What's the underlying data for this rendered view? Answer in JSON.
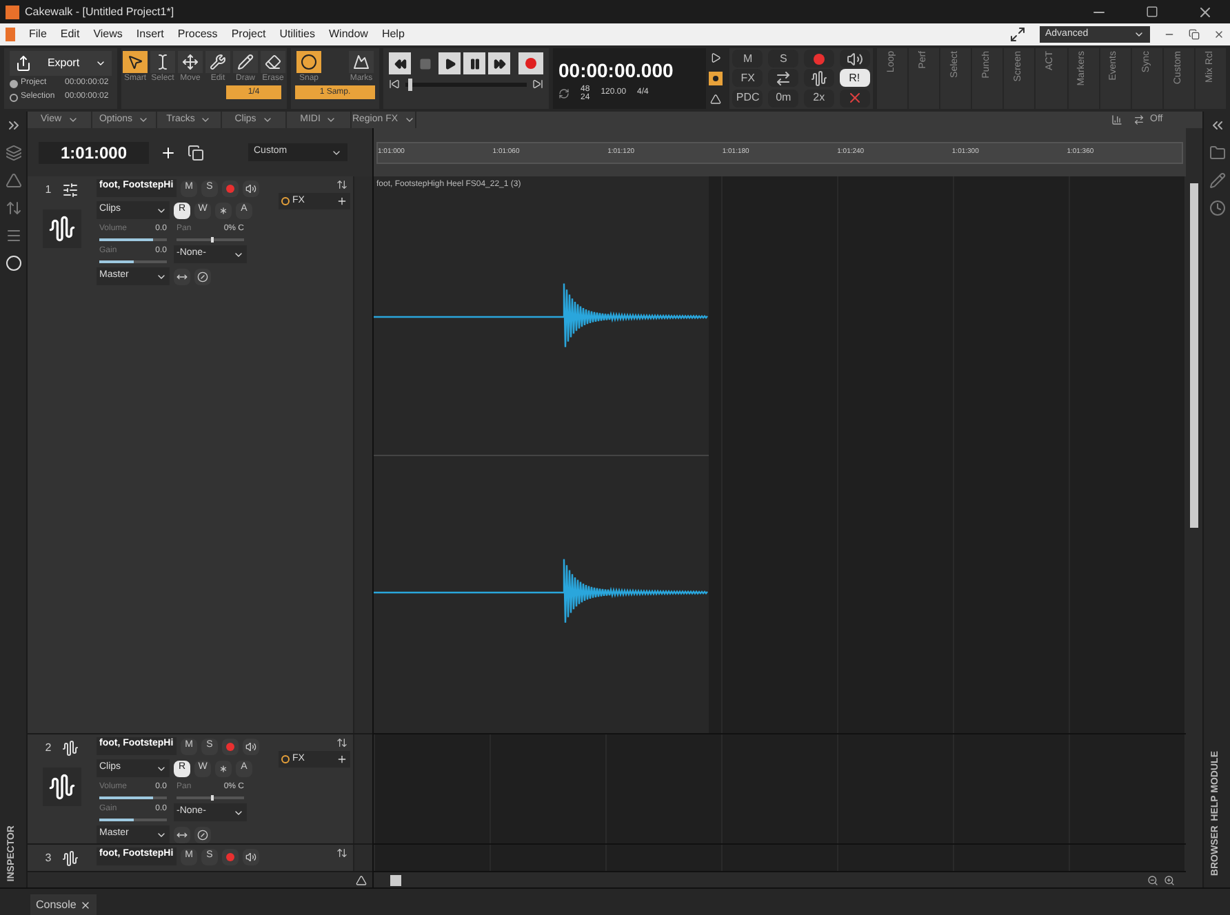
{
  "window": {
    "title": "Cakewalk - [Untitled Project1*]"
  },
  "menu": [
    "File",
    "Edit",
    "Views",
    "Insert",
    "Process",
    "Project",
    "Utilities",
    "Window",
    "Help"
  ],
  "workspace": {
    "value": "Advanced"
  },
  "export": {
    "label": "Export",
    "options": [
      {
        "label": "Project",
        "time": "00:00:00:02",
        "selected": true
      },
      {
        "label": "Selection",
        "time": "00:00:00:02",
        "selected": false
      }
    ]
  },
  "tools": [
    {
      "kind": "smart",
      "label": "Smart",
      "selected": true
    },
    {
      "kind": "select",
      "label": "Select",
      "selected": false
    },
    {
      "kind": "move",
      "label": "Move",
      "selected": false
    },
    {
      "kind": "edit",
      "label": "Edit",
      "selected": false
    },
    {
      "kind": "draw",
      "label": "Draw",
      "selected": false
    },
    {
      "kind": "erase",
      "label": "Erase",
      "selected": false
    }
  ],
  "tool_resolution": "1/4",
  "snap": {
    "label": "Snap",
    "on": true,
    "value": "1 Samp."
  },
  "marks": {
    "label": "Marks"
  },
  "transport": {
    "time": "00:00:00.000",
    "sample_rate": "48",
    "bit_depth": "24",
    "tempo": "120.00",
    "meter": "4/4",
    "record_mode_on": true,
    "position": {
      "level": 0.02
    }
  },
  "mix": [
    {
      "kind": "text",
      "label": "M",
      "selected": false
    },
    {
      "kind": "text",
      "label": "S",
      "selected": false
    },
    {
      "kind": "record",
      "selected": false
    },
    {
      "kind": "speaker",
      "selected": false
    },
    {
      "kind": "text",
      "label": "FX",
      "selected": false
    },
    {
      "kind": "swap",
      "selected": false
    },
    {
      "kind": "wave",
      "selected": false
    },
    {
      "kind": "text",
      "label": "R!",
      "selected": true
    },
    {
      "kind": "text",
      "label": "PDC",
      "selected": false
    },
    {
      "kind": "text",
      "label": "0m",
      "selected": false
    },
    {
      "kind": "text",
      "label": "2x",
      "selected": false
    },
    {
      "kind": "crossed",
      "selected": false
    }
  ],
  "modules": [
    "Loop",
    "Perf",
    "Select",
    "Punch",
    "Screen",
    "ACT",
    "Markers",
    "Events",
    "Sync",
    "Custom",
    "Mix Rcl"
  ],
  "track_menus": [
    "View",
    "Options",
    "Tracks",
    "Clips",
    "MIDI",
    "Region FX"
  ],
  "snap_grid": {
    "value": "Off"
  },
  "now_time": "1:01:000",
  "lens": {
    "value": "Custom"
  },
  "ruler": [
    "1:01:000",
    "1:01:060",
    "1:01:120",
    "1:01:180",
    "1:01:240",
    "1:01:300",
    "1:01:360"
  ],
  "tracks": [
    {
      "number": "1",
      "name": "foot, FootstepHi",
      "kind": "full",
      "mute": "M",
      "solo": "S",
      "read": {
        "label": "R",
        "on": true
      },
      "write": "W",
      "archive": "A",
      "input": "Clips",
      "volume": {
        "label": "Volume",
        "value": "0.0",
        "level": 0.8
      },
      "pan": {
        "label": "Pan",
        "value": "0% C",
        "level": 0.5
      },
      "gain": {
        "label": "Gain",
        "value": "0.0",
        "level": 0.5
      },
      "send": "-None-",
      "output": "Master",
      "fx": "FX",
      "clip": {
        "title": "foot, FootstepHigh Heel FS04_22_1 (3)"
      }
    },
    {
      "number": "2",
      "name": "foot, FootstepHi",
      "kind": "full",
      "mute": "M",
      "solo": "S",
      "read": {
        "label": "R",
        "on": true
      },
      "write": "W",
      "archive": "A",
      "input": "Clips",
      "volume": {
        "label": "Volume",
        "value": "0.0",
        "level": 0.8
      },
      "pan": {
        "label": "Pan",
        "value": "0% C",
        "level": 0.5
      },
      "gain": {
        "label": "Gain",
        "value": "0.0",
        "level": 0.5
      },
      "send": "-None-",
      "output": "Master",
      "fx": "FX"
    },
    {
      "number": "3",
      "name": "foot, FootstepHi",
      "kind": "collapsed",
      "mute": "M",
      "solo": "S"
    }
  ],
  "side_tabs": [
    "BROWSER",
    "HELP MODULE"
  ],
  "inspector": {
    "label": "INSPECTOR"
  },
  "console": {
    "label": "Console"
  }
}
